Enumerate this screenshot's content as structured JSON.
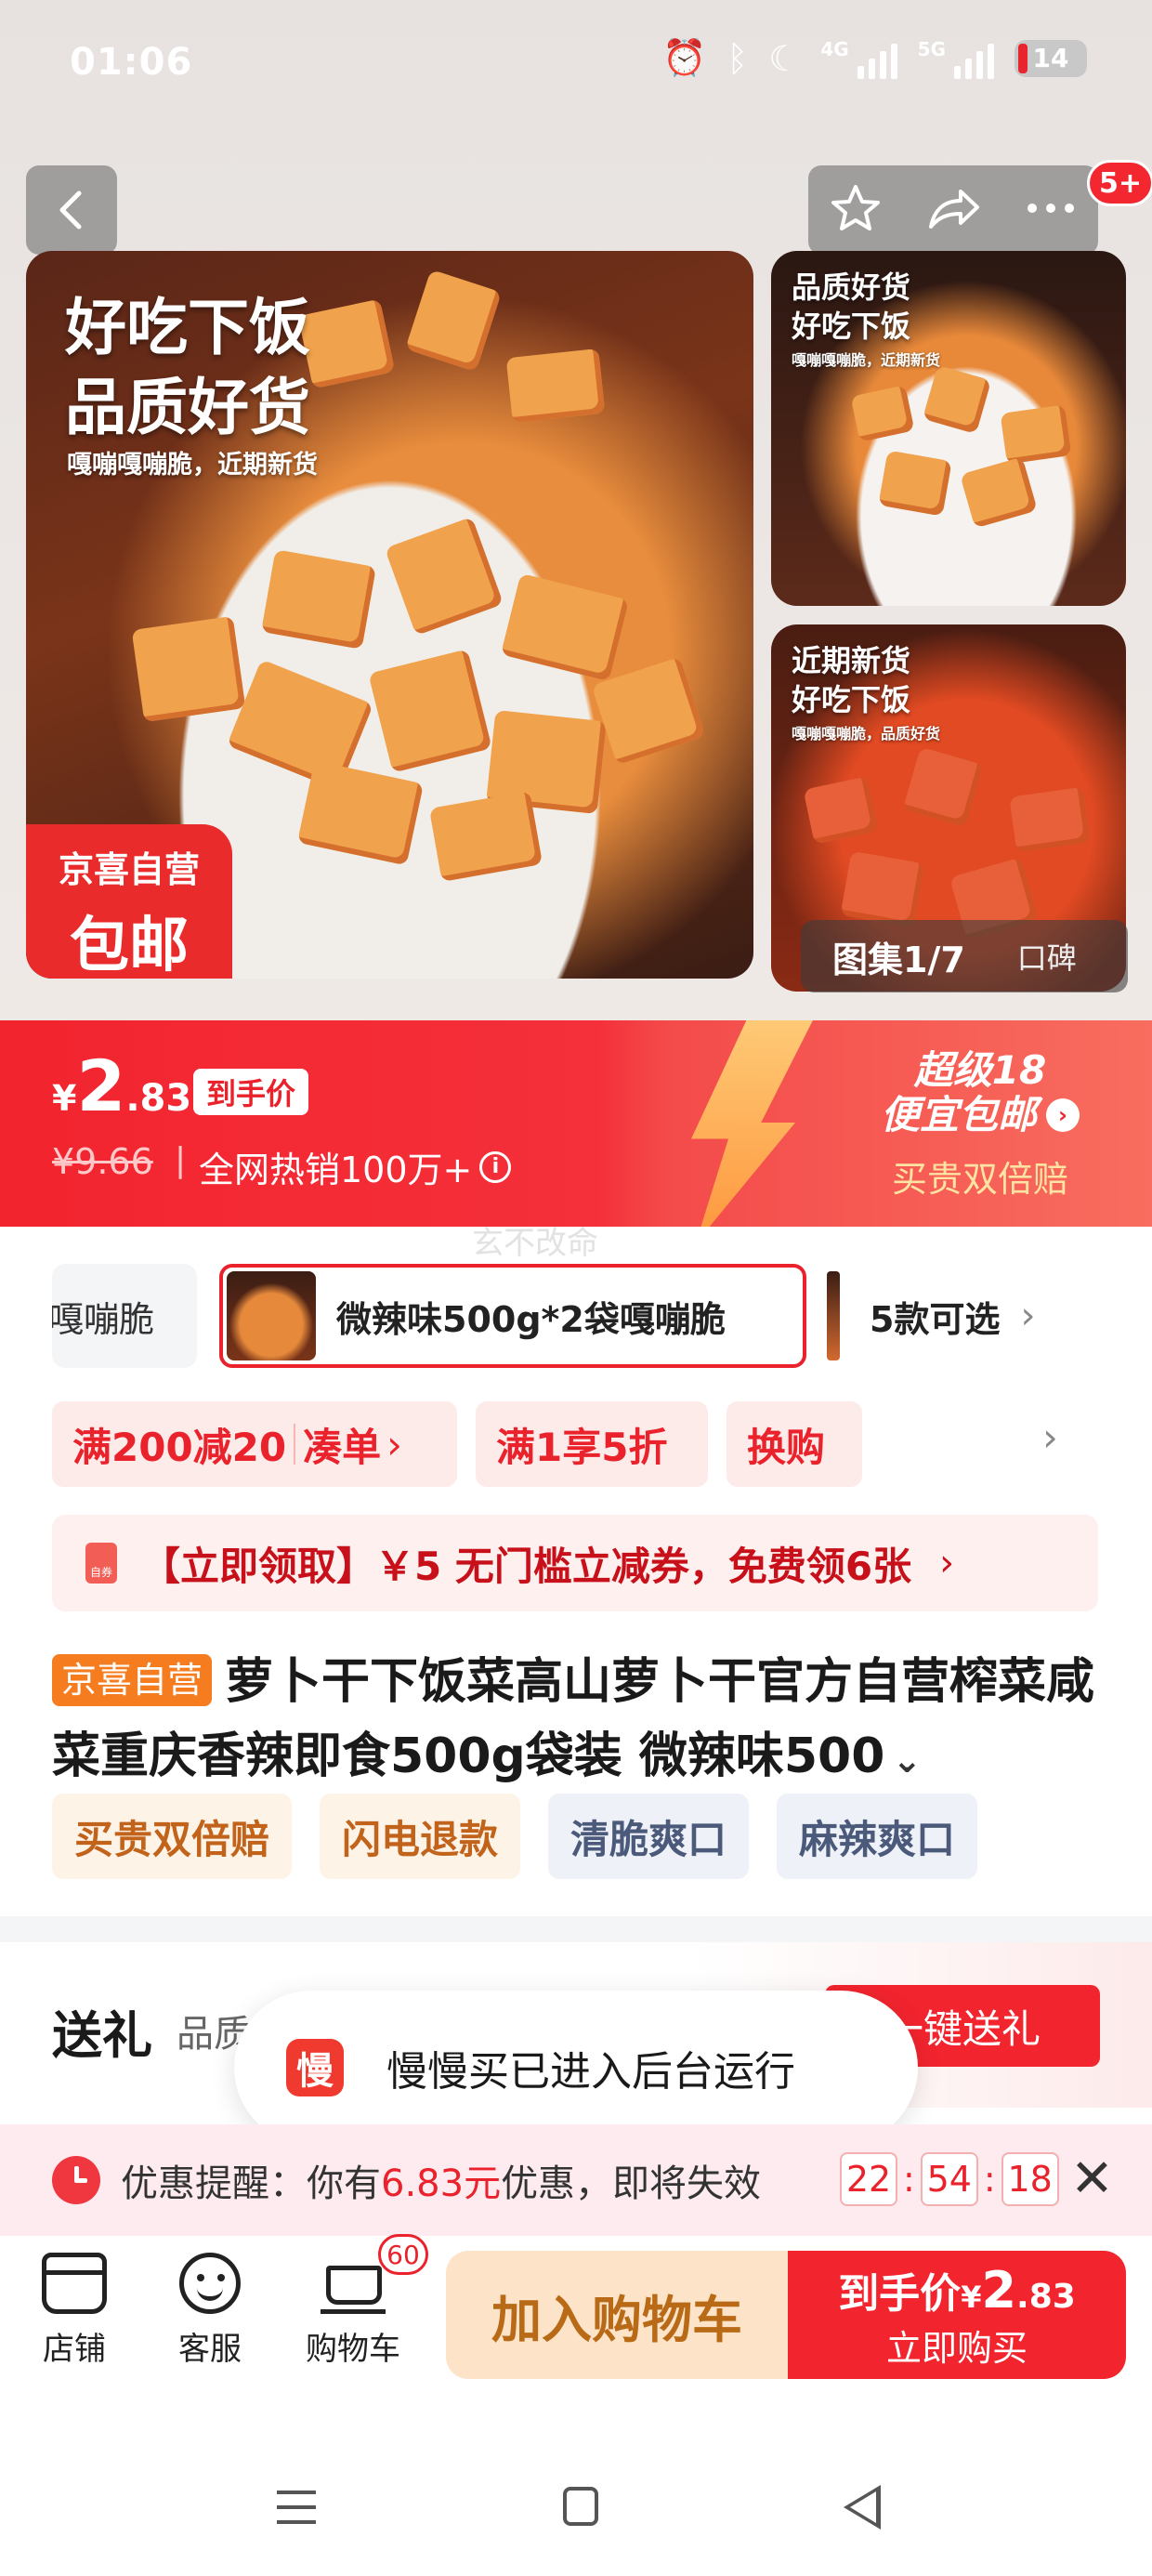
{
  "status_bar": {
    "time": "01:06",
    "network_1": "4G",
    "network_2": "5G",
    "battery": "14",
    "icons": [
      "alarm-icon",
      "bluetooth-icon",
      "moon-icon",
      "signal-icon",
      "battery-icon"
    ]
  },
  "nav": {
    "notification_badge": "5+"
  },
  "gallery": {
    "main_title_line1": "好吃下饭",
    "main_title_line2": "品质好货",
    "main_subtitle": "嘎嘣嘎嘣脆，近期新货",
    "promo_line1": "京喜自营",
    "promo_line2": "包邮",
    "side1_line1": "品质好货",
    "side1_line2": "好吃下饭",
    "side1_sub": "嘎嘣嘎嘣脆，近期新货",
    "side2_line1": "近期新货",
    "side2_line2": "好吃下饭",
    "side2_sub": "嘎嘣嘎嘣脆，品质好货",
    "count": "图集1/7",
    "right_label": "口碑"
  },
  "price": {
    "currency": "¥",
    "integer": "2",
    "decimal": ".83",
    "to_hand_label": "到手价",
    "original": "¥9.66",
    "separator": "|",
    "hot_sales": "全网热销100万+",
    "super_line1": "超级18",
    "super_line2": "便宜包邮",
    "guarantee": "买贵双倍赔"
  },
  "watermark": "玄不改命",
  "variants": {
    "prev_partial": "嘎嘣脆",
    "selected": "微辣味500g*2袋嘎嘣脆",
    "more": "5款可选"
  },
  "coupons": {
    "c1": "满200减20",
    "c1_action": "凑单",
    "c2": "满1享5折",
    "c3": "换购"
  },
  "voucher": {
    "icon_label": "自券",
    "text": "【立即领取】￥5 无门槛立减券，免费领6张"
  },
  "product": {
    "tag": "京喜自营",
    "title": "萝卜干下饭菜高山萝卜干官方自营榨菜咸菜重庆香辣即食500g袋装 微辣味500",
    "tags": [
      "买贵双倍赔",
      "闪电退款",
      "清脆爽口",
      "麻辣爽口"
    ]
  },
  "gift": {
    "label": "送礼",
    "sub": "品质",
    "button": "一键送礼"
  },
  "toast": {
    "icon_char": "慢",
    "text": "慢慢买已进入后台运行"
  },
  "reminder": {
    "prefix": "优惠提醒：你有",
    "amount": "6.83元",
    "suffix": "优惠，即将失效",
    "hh": "22",
    "mm": "54",
    "ss": "18"
  },
  "bottom_bar": {
    "shop": "店铺",
    "service": "客服",
    "cart": "购物车",
    "cart_count": "60",
    "add_to_cart": "加入购物车",
    "buy_line1_prefix": "到手价",
    "buy_currency": "¥",
    "buy_integer": "2",
    "buy_decimal": ".83",
    "buy_line2": "立即购买"
  },
  "colors": {
    "brand_red": "#f2242e",
    "coupon_bg": "#fdebea",
    "cart_button_bg": "#fde3c8",
    "jx_tag": "#f57d20"
  }
}
